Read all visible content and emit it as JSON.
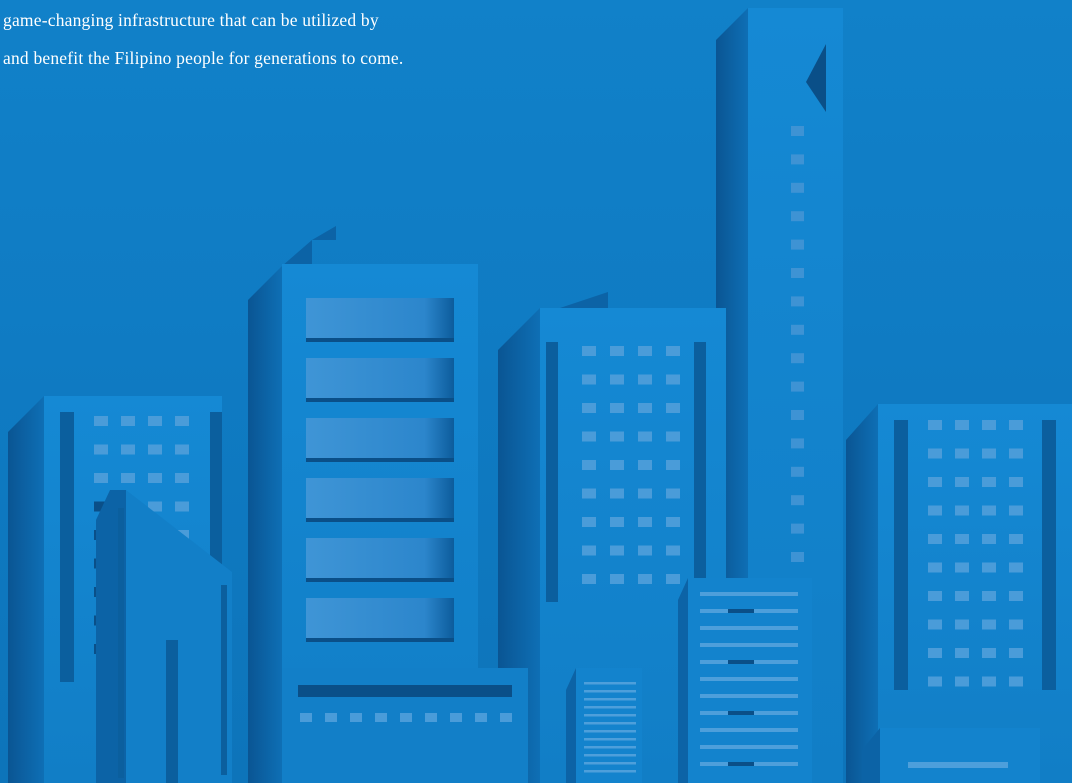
{
  "intro": {
    "line1": "game-changing infrastructure that can be utilized by",
    "line2": "and benefit the Filipino people for generations to come."
  },
  "illustration": {
    "subject": "city-skyline",
    "colors": {
      "background": "#0f7bc3",
      "building_face": "#1387d2",
      "building_side": "#0b5f9e",
      "window_light": "#5aa6de",
      "window_dark": "#0a4f88"
    }
  }
}
